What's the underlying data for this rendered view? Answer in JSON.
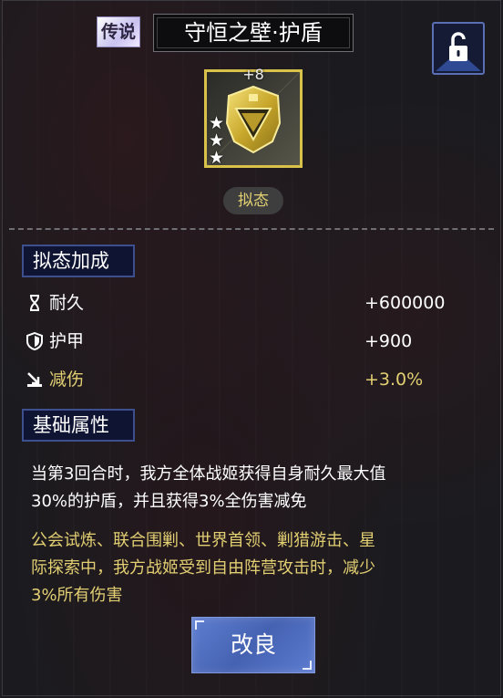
{
  "header": {
    "rarity": "传说",
    "title": "守恒之壁·护盾",
    "lock_icon": "unlocked-padlock-icon"
  },
  "item": {
    "level": "+8",
    "stars": 3,
    "icon": "golden-shield-icon",
    "state": "拟态"
  },
  "mimic_bonus": {
    "header": "拟态加成",
    "stats": [
      {
        "icon": "hourglass-icon",
        "label": "耐久",
        "value": "+600000",
        "color": "#ffffff"
      },
      {
        "icon": "shield-icon",
        "label": "护甲",
        "value": "+900",
        "color": "#ffffff"
      },
      {
        "icon": "damage-reduction-icon",
        "label": "减伤",
        "value": "+3.0%",
        "color": "#e2cf72"
      }
    ]
  },
  "base_attributes": {
    "header": "基础属性",
    "description_lines": [
      "当第3回合时，我方全体战姬获得自身耐久最大值",
      "30%的护盾，并且获得3%全伤害减免"
    ],
    "condition_lines": [
      "公会试炼、联合围剿、世界首领、剿猎游击、星",
      "际探索中，我方战姬受到自由阵营攻击时，减少",
      "3%所有伤害"
    ]
  },
  "actions": {
    "upgrade_label": "改良"
  },
  "colors": {
    "gold": "#e2cf72",
    "section_bg": "#0f1433",
    "section_border": "#3d4f8e",
    "button_blue": "#4562b2"
  }
}
